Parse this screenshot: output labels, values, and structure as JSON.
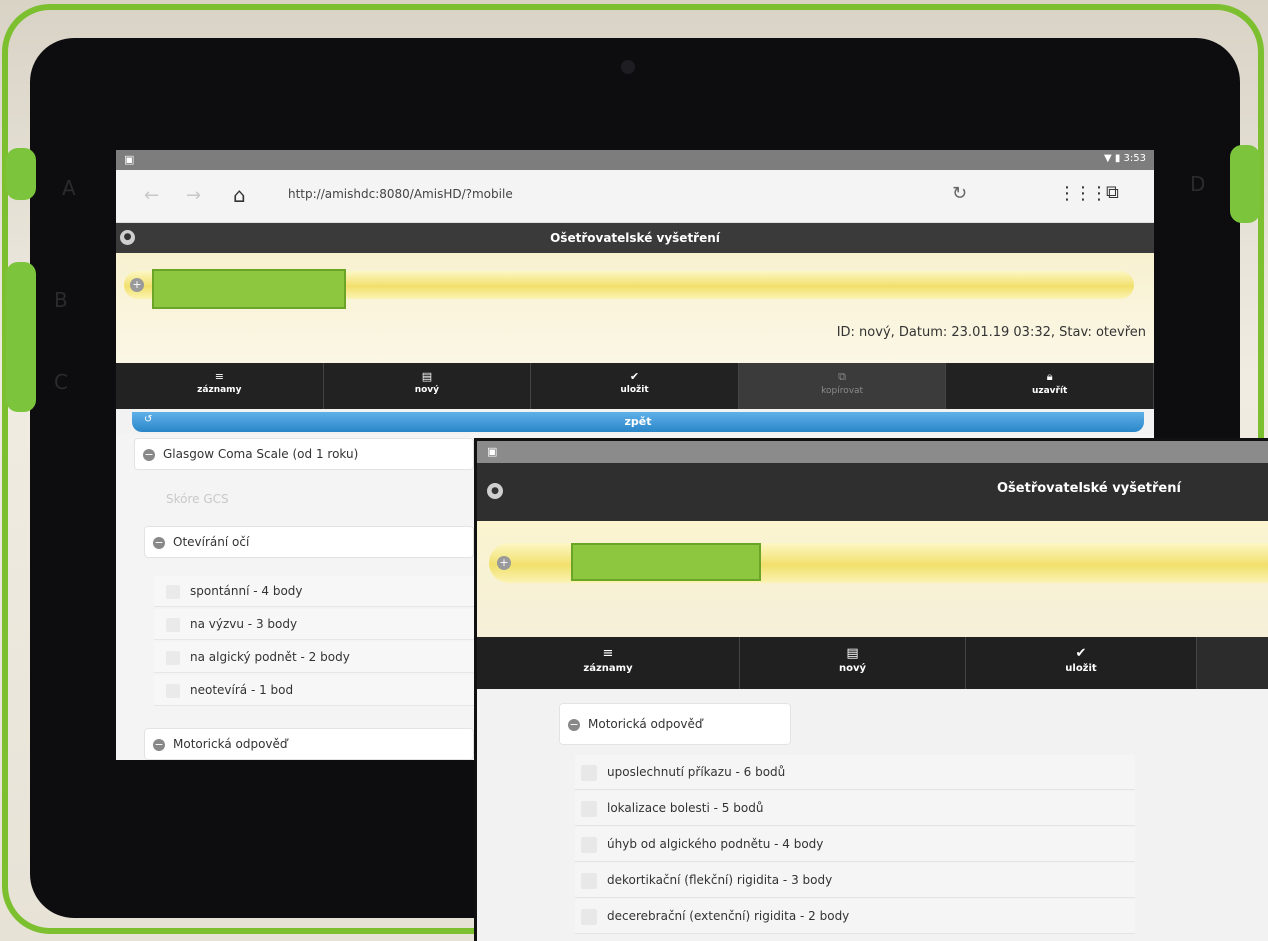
{
  "device": {
    "side_letters": [
      "A",
      "B",
      "C",
      "D"
    ]
  },
  "back_screen": {
    "status": {
      "time": "3:53",
      "left_icon": "notification-icon"
    },
    "browser": {
      "url": "http://amishdc:8080/AmisHD/?mobile"
    },
    "header": {
      "title": "Ošetřovatelské vyšetření"
    },
    "info_line": "ID: nový, Datum: 23.01.19 03:32, Stav: otevřen",
    "toolbar": [
      {
        "label": "záznamy",
        "icon": "list-icon"
      },
      {
        "label": "nový",
        "icon": "document-icon"
      },
      {
        "label": "uložit",
        "icon": "check-icon"
      },
      {
        "label": "kopírovat",
        "icon": "copy-icon"
      },
      {
        "label": "uzavřít",
        "icon": "lock-icon"
      }
    ],
    "back_button": {
      "label": "zpět"
    },
    "gcs_group": {
      "label": "Glasgow Coma Scale (od 1 roku)"
    },
    "score_label": "Skóre GCS",
    "eyes_group": {
      "label": "Otevírání očí"
    },
    "eye_options": [
      "spontánní - 4 body",
      "na výzvu - 3 body",
      "na algický podnět - 2 body",
      "neotevírá - 1 bod"
    ],
    "motor_group": {
      "label": "Motorická odpověď"
    }
  },
  "front_screen": {
    "header": {
      "title": "Ošetřovatelské vyšetření"
    },
    "toolbar": [
      {
        "label": "záznamy",
        "icon": "list-icon"
      },
      {
        "label": "nový",
        "icon": "document-icon"
      },
      {
        "label": "uložit",
        "icon": "check-icon"
      }
    ],
    "motor_group": {
      "label": "Motorická odpověď"
    },
    "motor_options": [
      "uposlechnutí příkazu - 6 bodů",
      "lokalizace bolesti - 5 bodů",
      "úhyb od algického podnětu - 4 body",
      "dekortikační (flekční) rigidita - 3 body",
      "decerebrační (extenční) rigidita - 2 body"
    ]
  },
  "colors": {
    "accent_blue": "#2a86c9",
    "patient_yellow": "#f1e06c",
    "redaction_green": "#8dc63f",
    "toolbar_dark": "#222222",
    "device_green": "#7cbf2f"
  }
}
